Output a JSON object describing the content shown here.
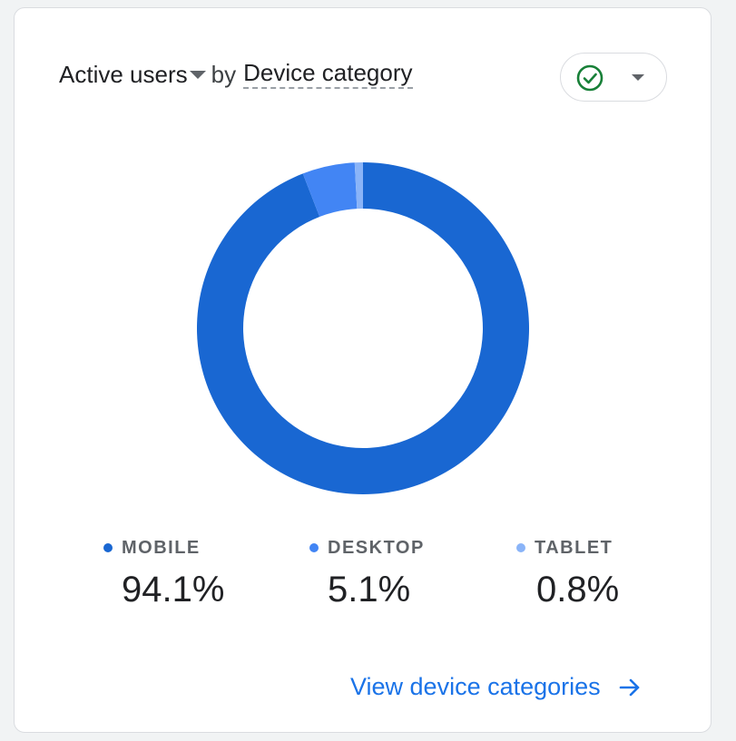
{
  "card": {
    "title_metric": "Active users",
    "title_by": "by",
    "title_dimension": "Device category",
    "compare_icon": "check-circle-icon",
    "compare_caret_icon": "arrow-drop-down-icon",
    "link_label": "View device categories",
    "link_icon": "arrow-forward-icon"
  },
  "chart_data": {
    "type": "pie",
    "style": "donut",
    "categories": [
      "MOBILE",
      "DESKTOP",
      "TABLET"
    ],
    "values": [
      94.1,
      5.1,
      0.8
    ],
    "value_labels": [
      "94.1%",
      "5.1%",
      "0.8%"
    ],
    "colors": [
      "#1967d2",
      "#4285f4",
      "#8ab4f8"
    ],
    "legend_position": "bottom"
  },
  "colors": {
    "accent": "#1a73e8",
    "check_green": "#188038"
  }
}
